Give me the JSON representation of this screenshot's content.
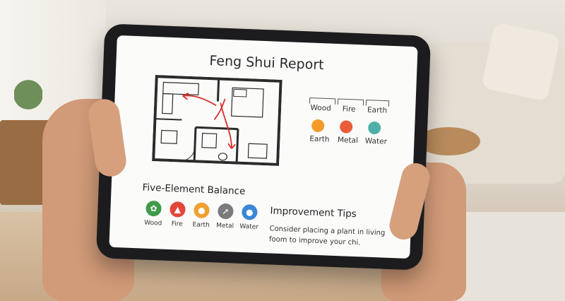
{
  "report": {
    "title": "Feng Shui Report",
    "legend": [
      {
        "label": "Wood",
        "icon": "wood-tick-icon"
      },
      {
        "label": "Fire",
        "icon": "fire-tick-icon"
      },
      {
        "label": "Earth",
        "icon": "earth-tick-icon"
      },
      {
        "label": "Earth",
        "icon": "earth-circle-icon",
        "color": "#f39a2b"
      },
      {
        "label": "Metal",
        "icon": "metal-circle-icon",
        "color": "#e85c3a"
      },
      {
        "label": "Water",
        "icon": "water-circle-icon",
        "color": "#4fb0a8"
      }
    ],
    "balance": {
      "title": "Five-Element Balance",
      "elements": [
        {
          "label": "Wood",
          "icon": "leaf-icon",
          "color": "#3f9b4a"
        },
        {
          "label": "Fire",
          "icon": "flame-icon",
          "color": "#e2473a"
        },
        {
          "label": "Earth",
          "icon": "drop-icon",
          "color": "#f0a030"
        },
        {
          "label": "Metal",
          "icon": "arrow-icon",
          "color": "#7b7b7b"
        },
        {
          "label": "Water",
          "icon": "water-drop-icon",
          "color": "#3a86d6"
        }
      ]
    },
    "tips": {
      "title": "Improvement Tips",
      "text": "Consider placing a plant in living foom to improve your chi."
    }
  }
}
